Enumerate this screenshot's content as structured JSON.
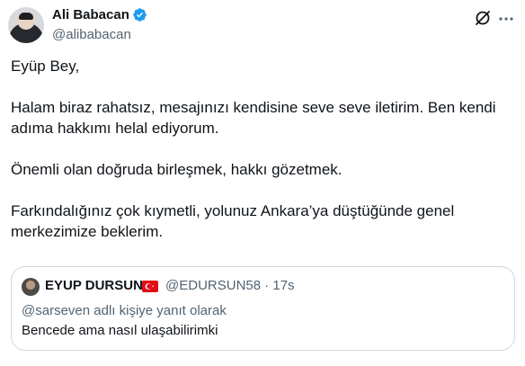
{
  "author": {
    "name": "Ali Babacan",
    "handle": "@alibabacan",
    "verified_color": "#1d9bf0"
  },
  "tweet": {
    "paragraphs": [
      "Eyüp Bey,",
      "Halam biraz rahatsız, mesajınızı kendisine seve seve iletirim. Ben kendi adıma hakkımı helal ediyorum.",
      "Önemli olan doğruda birleşmek, hakkı gözetmek.",
      "Farkındalığınız çok kıymetli, yolunuz Ankara’ya düştüğünde genel merkezimize beklerim."
    ]
  },
  "quoted": {
    "name": "EYUP DURSUN",
    "handle_time": "@EDURSUN58 · 17s",
    "reply_context": "@sarseven adlı kişiye yanıt olarak",
    "text": "Bencede ama nasıl ulaşabilirimki",
    "flag_color": "#e30a17"
  },
  "icons": {
    "header": [
      "grok-icon",
      "more-icon"
    ]
  }
}
